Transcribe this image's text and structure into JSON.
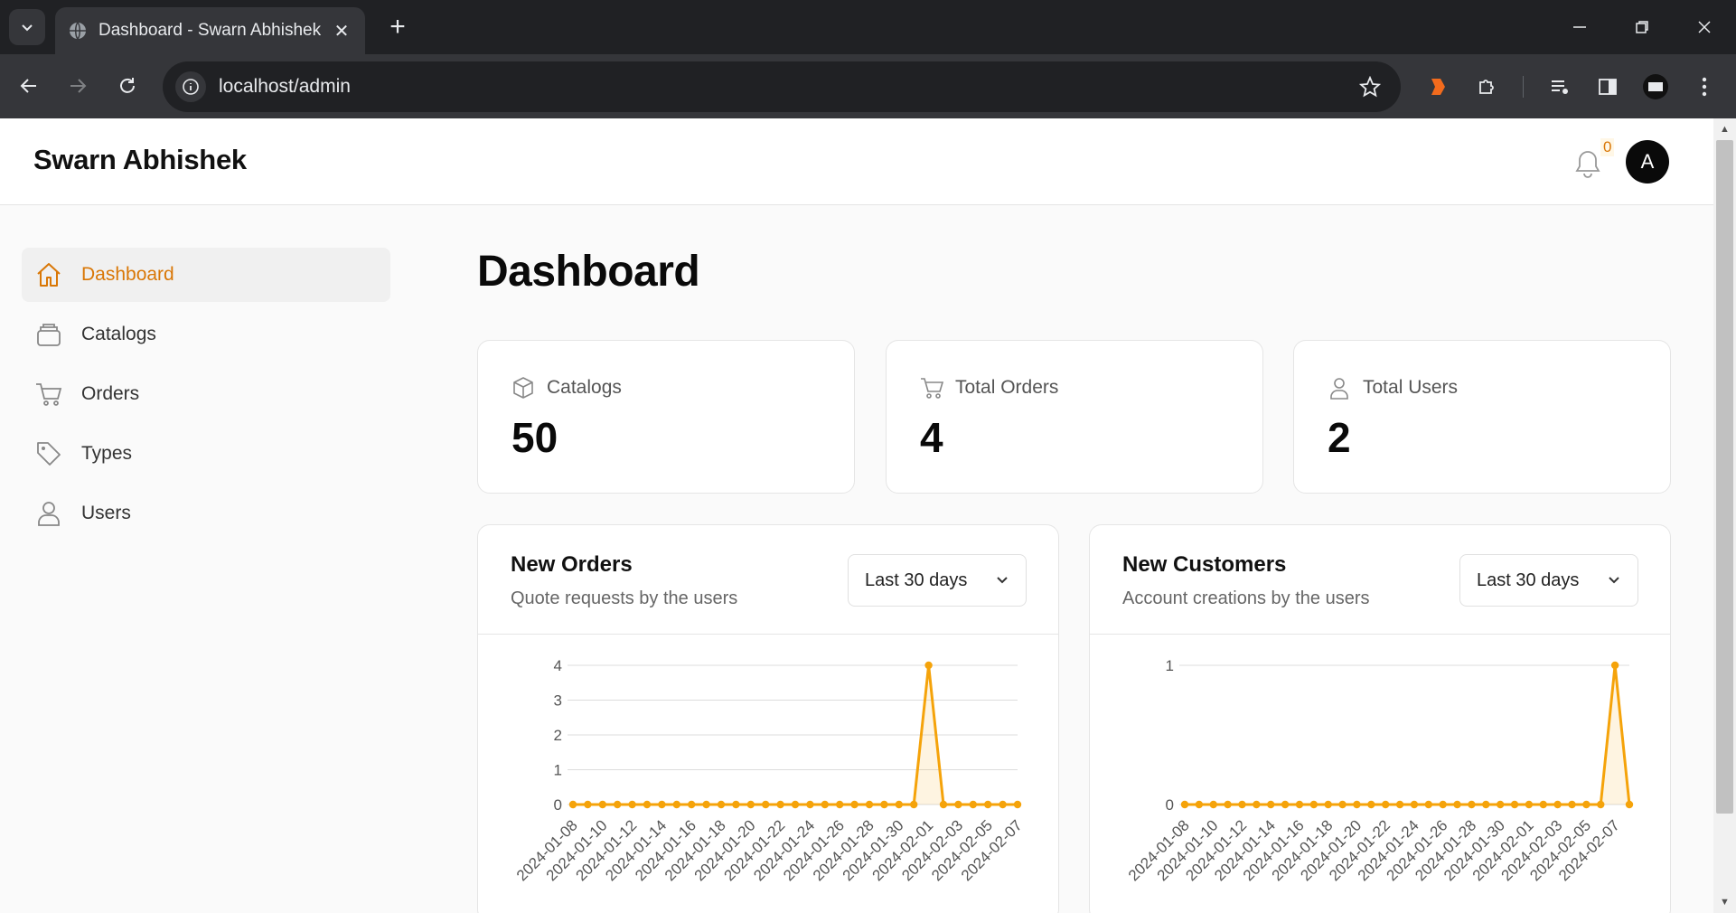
{
  "browser": {
    "tab_title": "Dashboard - Swarn Abhishek",
    "url": "localhost/admin"
  },
  "header": {
    "brand": "Swarn Abhishek",
    "notification_count": "0",
    "avatar_initial": "A"
  },
  "sidebar": {
    "items": [
      {
        "label": "Dashboard",
        "icon": "home-icon",
        "active": true
      },
      {
        "label": "Catalogs",
        "icon": "catalog-icon",
        "active": false
      },
      {
        "label": "Orders",
        "icon": "cart-icon",
        "active": false
      },
      {
        "label": "Types",
        "icon": "tag-icon",
        "active": false
      },
      {
        "label": "Users",
        "icon": "user-icon",
        "active": false
      }
    ]
  },
  "main": {
    "title": "Dashboard",
    "stats": [
      {
        "label": "Catalogs",
        "value": "50",
        "icon": "box-icon"
      },
      {
        "label": "Total Orders",
        "value": "4",
        "icon": "cart-icon"
      },
      {
        "label": "Total Users",
        "value": "2",
        "icon": "user-icon"
      }
    ],
    "charts": [
      {
        "title": "New Orders",
        "subtitle": "Quote requests by the users",
        "range": "Last 30 days"
      },
      {
        "title": "New Customers",
        "subtitle": "Account creations by the users",
        "range": "Last 30 days"
      }
    ]
  },
  "colors": {
    "accent": "#d97706",
    "line": "#f5a30a"
  },
  "chart_data": [
    {
      "type": "line",
      "title": "New Orders",
      "x": [
        "2024-01-08",
        "2024-01-09",
        "2024-01-10",
        "2024-01-11",
        "2024-01-12",
        "2024-01-13",
        "2024-01-14",
        "2024-01-15",
        "2024-01-16",
        "2024-01-17",
        "2024-01-18",
        "2024-01-19",
        "2024-01-20",
        "2024-01-21",
        "2024-01-22",
        "2024-01-23",
        "2024-01-24",
        "2024-01-25",
        "2024-01-26",
        "2024-01-27",
        "2024-01-28",
        "2024-01-29",
        "2024-01-30",
        "2024-01-31",
        "2024-02-01",
        "2024-02-02",
        "2024-02-03",
        "2024-02-04",
        "2024-02-05",
        "2024-02-06",
        "2024-02-07"
      ],
      "tick_labels": [
        "2024-01-08",
        "2024-01-10",
        "2024-01-12",
        "2024-01-14",
        "2024-01-16",
        "2024-01-18",
        "2024-01-20",
        "2024-01-22",
        "2024-01-24",
        "2024-01-26",
        "2024-01-28",
        "2024-01-30",
        "2024-02-01",
        "2024-02-03",
        "2024-02-05",
        "2024-02-07"
      ],
      "values": [
        0,
        0,
        0,
        0,
        0,
        0,
        0,
        0,
        0,
        0,
        0,
        0,
        0,
        0,
        0,
        0,
        0,
        0,
        0,
        0,
        0,
        0,
        0,
        0,
        4,
        0,
        0,
        0,
        0,
        0,
        0
      ],
      "yticks": [
        0,
        1,
        2,
        3,
        4
      ],
      "ylim": [
        0,
        4
      ],
      "grid": true
    },
    {
      "type": "line",
      "title": "New Customers",
      "x": [
        "2024-01-08",
        "2024-01-09",
        "2024-01-10",
        "2024-01-11",
        "2024-01-12",
        "2024-01-13",
        "2024-01-14",
        "2024-01-15",
        "2024-01-16",
        "2024-01-17",
        "2024-01-18",
        "2024-01-19",
        "2024-01-20",
        "2024-01-21",
        "2024-01-22",
        "2024-01-23",
        "2024-01-24",
        "2024-01-25",
        "2024-01-26",
        "2024-01-27",
        "2024-01-28",
        "2024-01-29",
        "2024-01-30",
        "2024-01-31",
        "2024-02-01",
        "2024-02-02",
        "2024-02-03",
        "2024-02-04",
        "2024-02-05",
        "2024-02-06",
        "2024-02-07",
        "2024-02-08"
      ],
      "tick_labels": [
        "2024-01-08",
        "2024-01-10",
        "2024-01-12",
        "2024-01-14",
        "2024-01-16",
        "2024-01-18",
        "2024-01-20",
        "2024-01-22",
        "2024-01-24",
        "2024-01-26",
        "2024-01-28",
        "2024-01-30",
        "2024-02-01",
        "2024-02-03",
        "2024-02-05",
        "2024-02-07"
      ],
      "values": [
        0,
        0,
        0,
        0,
        0,
        0,
        0,
        0,
        0,
        0,
        0,
        0,
        0,
        0,
        0,
        0,
        0,
        0,
        0,
        0,
        0,
        0,
        0,
        0,
        0,
        0,
        0,
        0,
        0,
        0,
        1,
        0
      ],
      "yticks": [
        0,
        1
      ],
      "ylim": [
        0,
        1
      ],
      "grid": true
    }
  ]
}
